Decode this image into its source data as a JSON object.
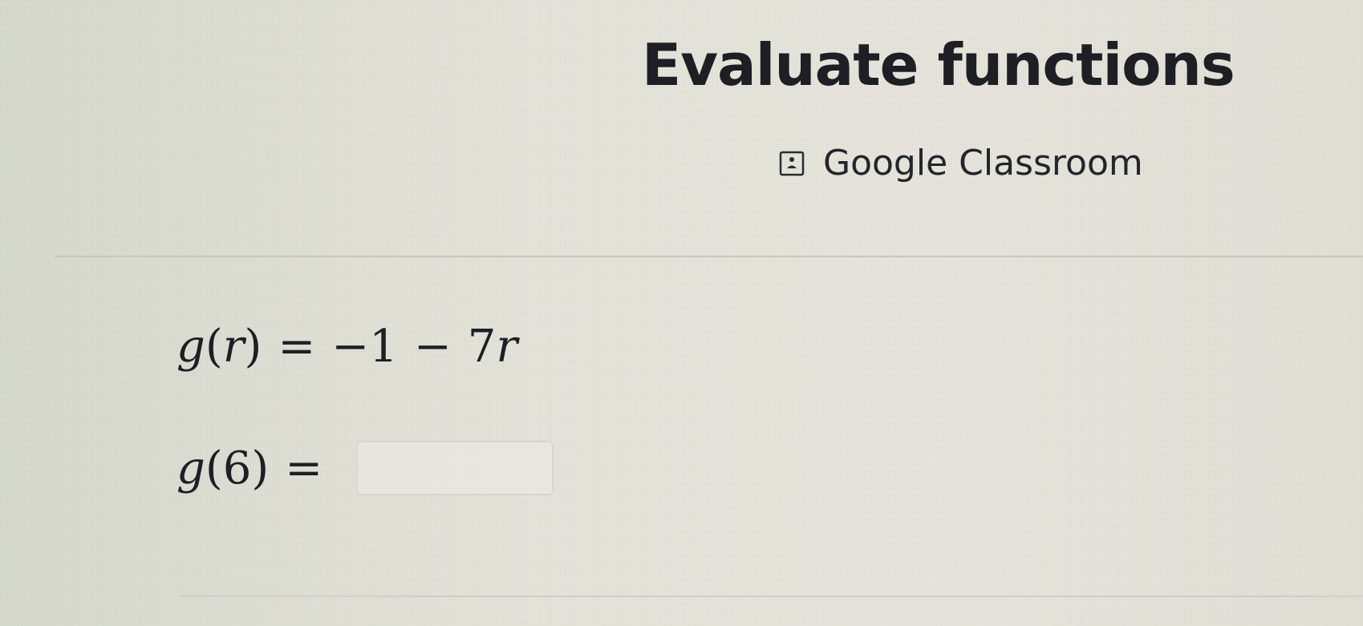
{
  "header": {
    "title": "Evaluate functions",
    "classroom_label": "Google Classroom",
    "classroom_icon": "google-classroom-icon"
  },
  "problem": {
    "function_name": "g",
    "variable": "r",
    "rhs_constant": "−1",
    "rhs_operator": "−",
    "rhs_term_coefficient": "7",
    "rhs_term_variable": "r",
    "evaluate_function_name": "g",
    "evaluate_argument": "6",
    "equals": "=",
    "answer_value": ""
  },
  "colors": {
    "background": "#e5e4dc",
    "text": "#1e1f24",
    "divider": "#c9c8bf"
  }
}
